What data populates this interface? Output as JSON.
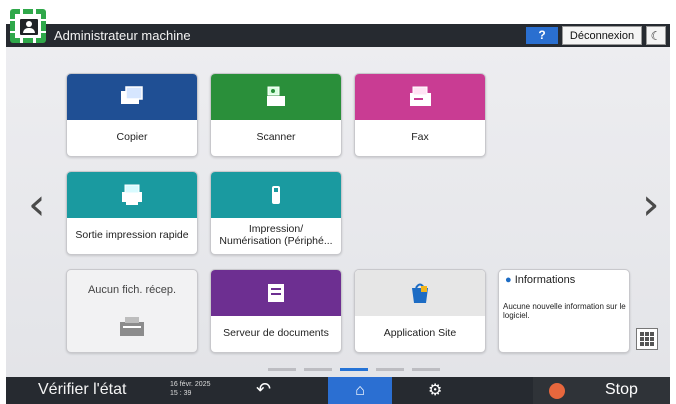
{
  "header": {
    "title": "Administrateur machine",
    "help_label": "?",
    "logout_label": "Déconnexion",
    "sleep_icon": "☾"
  },
  "nav": {
    "left_arrow": "‹",
    "right_arrow": "›"
  },
  "tiles": [
    {
      "label": "Copier",
      "color": "#1f4f94"
    },
    {
      "label": "Scanner",
      "color": "#2a8f3a"
    },
    {
      "label": "Fax",
      "color": "#c93c93"
    },
    {
      "label": "Sortie impression rapide",
      "color": "#1a9aa0"
    },
    {
      "label": "Impression/\nNumérisation (Périphé...",
      "color": "#1a9aa0"
    },
    {
      "label": "Aucun fich. récep."
    },
    {
      "label": "Serveur de documents",
      "color": "#6d2f91"
    },
    {
      "label": "Application Site",
      "color": "#e6e6e6"
    }
  ],
  "info": {
    "title": "Informations",
    "message": "Aucune nouvelle information sur le logiciel."
  },
  "bottom": {
    "check_status": "Vérifier l'état",
    "date": "16 févr. 2025",
    "time": "15 : 39",
    "back_icon": "↶",
    "home_icon": "⌂",
    "settings_icon": "⚙",
    "stop_label": "Stop"
  }
}
